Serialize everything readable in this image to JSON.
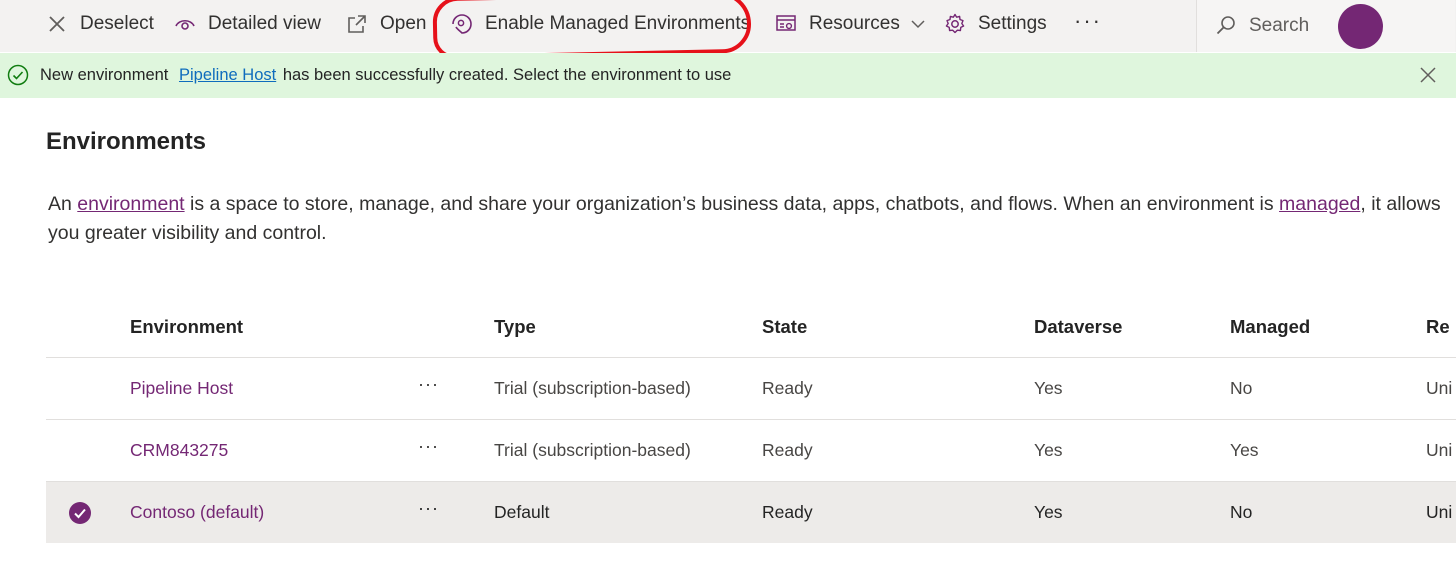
{
  "command_bar": {
    "deselect": "Deselect",
    "detailed_view": "Detailed view",
    "open": "Open",
    "enable_managed": "Enable Managed Environments",
    "resources": "Resources",
    "settings": "Settings",
    "more": "···",
    "search_placeholder": "Search",
    "icons": [
      "close-icon",
      "eye-icon",
      "open-external-icon",
      "managed-environment-icon",
      "resources-icon",
      "chevron-down-icon",
      "gear-icon",
      "search-icon"
    ]
  },
  "annotation": {
    "color": "#e6111a"
  },
  "notification": {
    "text_before": "New environment",
    "link": "Pipeline Host",
    "text_after": "has been successfully created. Select the environment to use"
  },
  "page": {
    "title": "Environments",
    "desc_1": "An",
    "desc_link_1": "environment",
    "desc_2": "is a space to store, manage, and share your organization’s business data, apps, chatbots, and flows. When an environment is",
    "desc_link_2": "managed",
    "desc_3": ", it allows you greater visibility and control."
  },
  "table": {
    "headers": {
      "environment": "Environment",
      "type": "Type",
      "state": "State",
      "dataverse": "Dataverse",
      "managed": "Managed",
      "region": "Re"
    },
    "rows": [
      {
        "environment": "Pipeline Host",
        "more": "···",
        "type": "Trial (subscription-based)",
        "state": "Ready",
        "dataverse": "Yes",
        "managed": "No",
        "region": "Uni",
        "selected": false
      },
      {
        "environment": "CRM843275",
        "more": "···",
        "type": "Trial (subscription-based)",
        "state": "Ready",
        "dataverse": "Yes",
        "managed": "Yes",
        "region": "Uni",
        "selected": false
      },
      {
        "environment": "Contoso (default)",
        "more": "···",
        "type": "Default",
        "state": "Ready",
        "dataverse": "Yes",
        "managed": "No",
        "region": "Uni",
        "selected": true
      }
    ]
  },
  "colors": {
    "accent": "#742774",
    "link": "#0f6cbd",
    "success_bg": "#dff6dd",
    "success_icon": "#107c10"
  }
}
